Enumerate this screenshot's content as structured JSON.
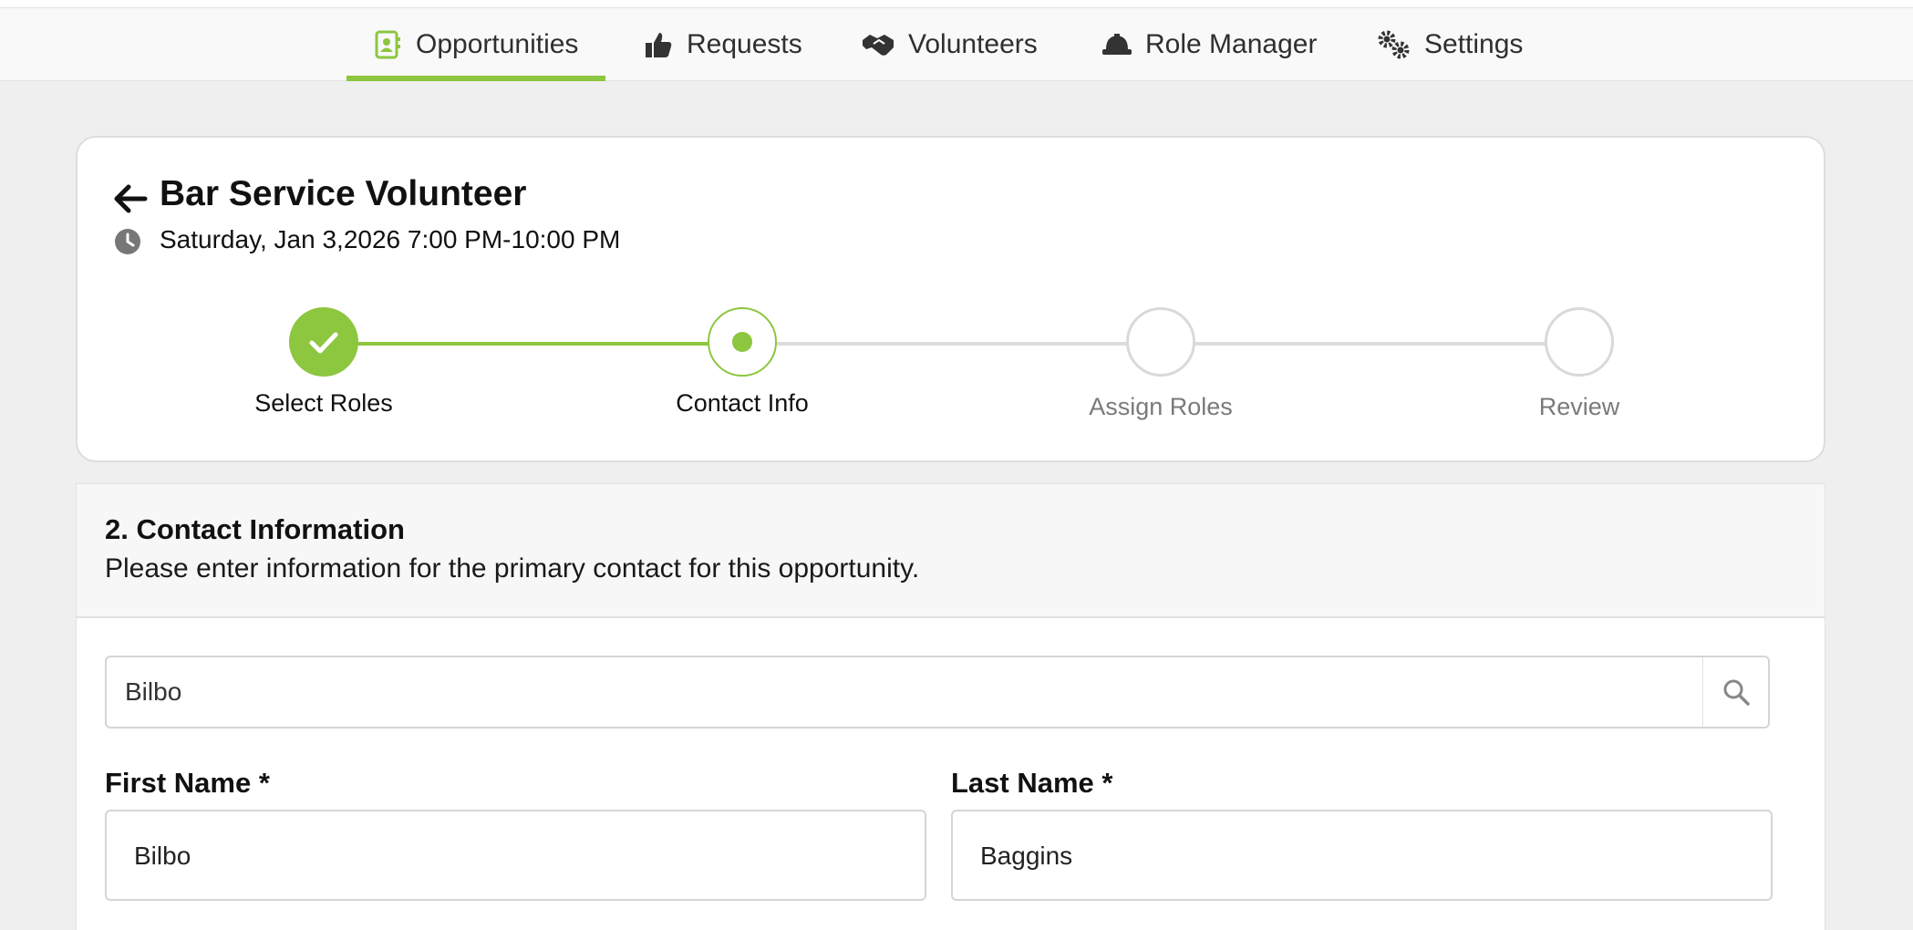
{
  "nav": {
    "items": [
      {
        "label": "Opportunities",
        "icon": "contact-book-icon",
        "active": true
      },
      {
        "label": "Requests",
        "icon": "thumbs-up-icon",
        "active": false
      },
      {
        "label": "Volunteers",
        "icon": "handshake-icon",
        "active": false
      },
      {
        "label": "Role Manager",
        "icon": "hard-hat-icon",
        "active": false
      },
      {
        "label": "Settings",
        "icon": "gears-icon",
        "active": false
      }
    ]
  },
  "opportunity": {
    "title": "Bar Service Volunteer",
    "datetime": "Saturday, Jan 3,2026 7:00 PM-10:00 PM"
  },
  "steps": [
    {
      "label": "Select Roles",
      "status": "complete"
    },
    {
      "label": "Contact Info",
      "status": "current"
    },
    {
      "label": "Assign Roles",
      "status": "upcoming"
    },
    {
      "label": "Review",
      "status": "upcoming"
    }
  ],
  "contact": {
    "heading": "2. Contact Information",
    "subheading": "Please enter information for the primary contact for this opportunity.",
    "search_value": "Bilbo",
    "first_name_label": "First Name *",
    "first_name_value": "Bilbo",
    "last_name_label": "Last Name *",
    "last_name_value": "Baggins"
  },
  "colors": {
    "accent": "#8dc63f",
    "inactive": "#d9d9d9"
  }
}
